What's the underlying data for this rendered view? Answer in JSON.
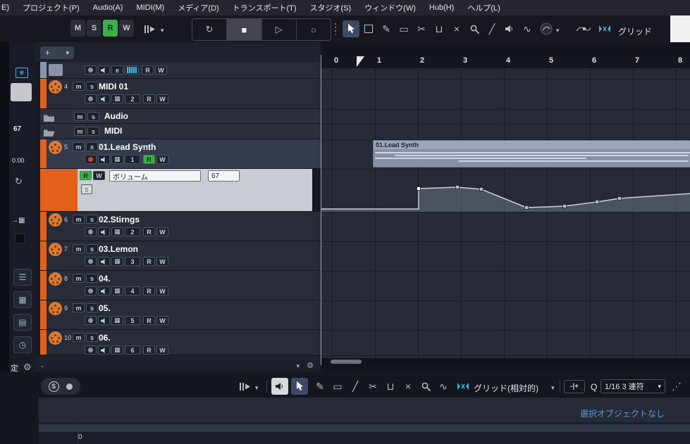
{
  "menubar": {
    "items": [
      "E)",
      "プロジェクト(P)",
      "Audio(A)",
      "MIDI(M)",
      "メディア(D)",
      "トランスポート(T)",
      "スタジオ(S)",
      "ウィンドウ(W)",
      "Hub(H)",
      "ヘルプ(L)"
    ]
  },
  "top_toolbar": {
    "mute": "M",
    "solo": "S",
    "read": "R",
    "write": "W",
    "grid_label": "グリッド"
  },
  "inspector": {
    "edit": "e",
    "value_top": "67",
    "value_mid": "0.00",
    "settings": "定"
  },
  "track_list": {
    "add": "+",
    "btn": {
      "m": "m",
      "s": "s",
      "r": "R",
      "w": "W",
      "e": "e"
    },
    "tracks": [
      {
        "num": "4",
        "name": "MIDI 01",
        "channel": "2"
      },
      {
        "name": "Audio"
      },
      {
        "name": "MIDI"
      },
      {
        "num": "5",
        "name": "01.Lead Synth",
        "channel": "1"
      },
      {
        "num": "6",
        "name": "02.Stirngs",
        "channel": "2"
      },
      {
        "num": "7",
        "name": "03.Lemon",
        "channel": "3"
      },
      {
        "num": "8",
        "name": "04.",
        "channel": "4"
      },
      {
        "num": "9",
        "name": "05.",
        "channel": "5"
      },
      {
        "num": "10",
        "name": "06.",
        "channel": "6"
      }
    ],
    "automation": {
      "parameter": "ボリューム",
      "value": "67"
    }
  },
  "ruler": {
    "marks": [
      "0",
      "1",
      "2",
      "3",
      "4",
      "5",
      "6",
      "7",
      "8"
    ]
  },
  "arrange": {
    "clip_title": "01.Lead Synth",
    "automation_points": [
      [
        0,
        57
      ],
      [
        138,
        57
      ],
      [
        138,
        28
      ],
      [
        193,
        26
      ],
      [
        227,
        29
      ],
      [
        291,
        55
      ],
      [
        345,
        53
      ],
      [
        391,
        47
      ],
      [
        423,
        42
      ],
      [
        524,
        35
      ]
    ],
    "automation_handles": [
      [
        138,
        28
      ],
      [
        193,
        26
      ],
      [
        227,
        29
      ],
      [
        291,
        55
      ],
      [
        345,
        53
      ],
      [
        391,
        47
      ],
      [
        423,
        42
      ]
    ]
  },
  "bottom": {
    "solo": "S",
    "grid_mode": "グリッド(相対的)",
    "nudge": "-|+",
    "q": "Q",
    "quantize": "1/16 3 連符",
    "info": "選択オブジェクトなし",
    "zero": "0"
  },
  "icons": {
    "dropdown": "▾",
    "plus": "+",
    "minus": "-",
    "loop": "↻",
    "stop": "■",
    "play": "▷",
    "record_circle": "○",
    "pencil": "✎",
    "eraser": "▭",
    "scissors": "✂",
    "glue": "⊔",
    "mute_x": "×",
    "line": "╱",
    "curve": "∿",
    "grid": "▦",
    "gear": "⚙",
    "clock": "◷",
    "mixer": "☰",
    "doc": "▤",
    "arrow_right": "→",
    "refresh": "↻",
    "bars": "▯",
    "tuplet": "⋰"
  },
  "colors": {
    "track_orange": "#e2601b",
    "read_green": "#3cae4a",
    "record_red": "#e03c3c",
    "snap_cyan": "#38b6e0",
    "info_blue": "#5f9ad8"
  }
}
